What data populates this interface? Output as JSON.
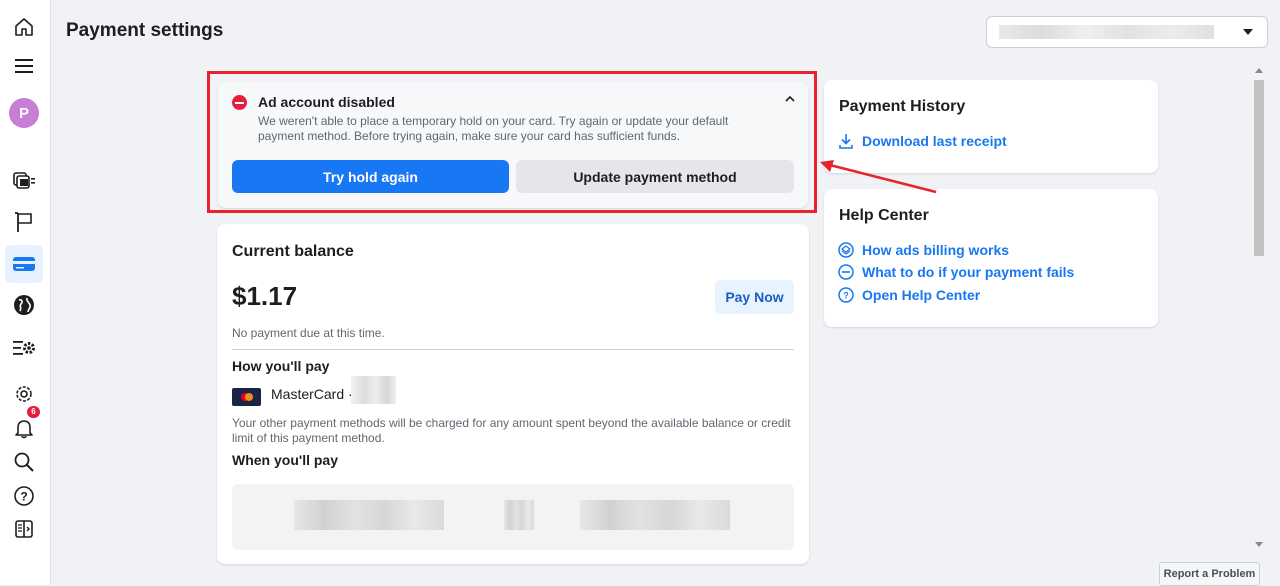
{
  "page": {
    "title": "Payment settings"
  },
  "sidebar": {
    "avatar_initial": "P",
    "notifications_badge": "6",
    "items": [
      {
        "name": "home-icon"
      },
      {
        "name": "menu-icon"
      },
      {
        "name": "avatar"
      },
      {
        "name": "campaigns-icon"
      },
      {
        "name": "flag-icon"
      },
      {
        "name": "billing-card-icon",
        "active": true
      },
      {
        "name": "globe-icon"
      },
      {
        "name": "ad-settings-icon"
      },
      {
        "name": "gear-icon"
      },
      {
        "name": "bell-icon"
      },
      {
        "name": "search-icon"
      },
      {
        "name": "help-icon"
      },
      {
        "name": "sidebar-toggle-icon"
      }
    ]
  },
  "alert": {
    "title": "Ad account disabled",
    "message": "We weren't able to place a temporary hold on your card. Try again or update your default payment method. Before trying again, make sure your card has sufficient funds.",
    "primary_button": "Try hold again",
    "secondary_button": "Update payment method",
    "highlight_color": "#e8232c"
  },
  "balance": {
    "title": "Current balance",
    "amount": "$1.17",
    "pay_now_label": "Pay Now",
    "note": "No payment due at this time.",
    "how_you_pay_title": "How you'll pay",
    "payment_method_label": "MasterCard ·",
    "payment_note": "Your other payment methods will be charged for any amount spent beyond the available balance or credit limit of this payment method.",
    "when_you_pay_title": "When you'll pay"
  },
  "payment_history": {
    "title": "Payment History",
    "download_label": "Download last receipt"
  },
  "help_center": {
    "title": "Help Center",
    "links": [
      {
        "label": "How ads billing works",
        "icon": "billing-help-icon"
      },
      {
        "label": "What to do if your payment fails",
        "icon": "minus-circle-icon"
      },
      {
        "label": "Open Help Center",
        "icon": "question-circle-icon"
      }
    ]
  },
  "footer": {
    "report_label": "Report a Problem"
  },
  "colors": {
    "primary": "#1877f2",
    "error": "#e41e3f",
    "background": "#f0f2f5"
  }
}
